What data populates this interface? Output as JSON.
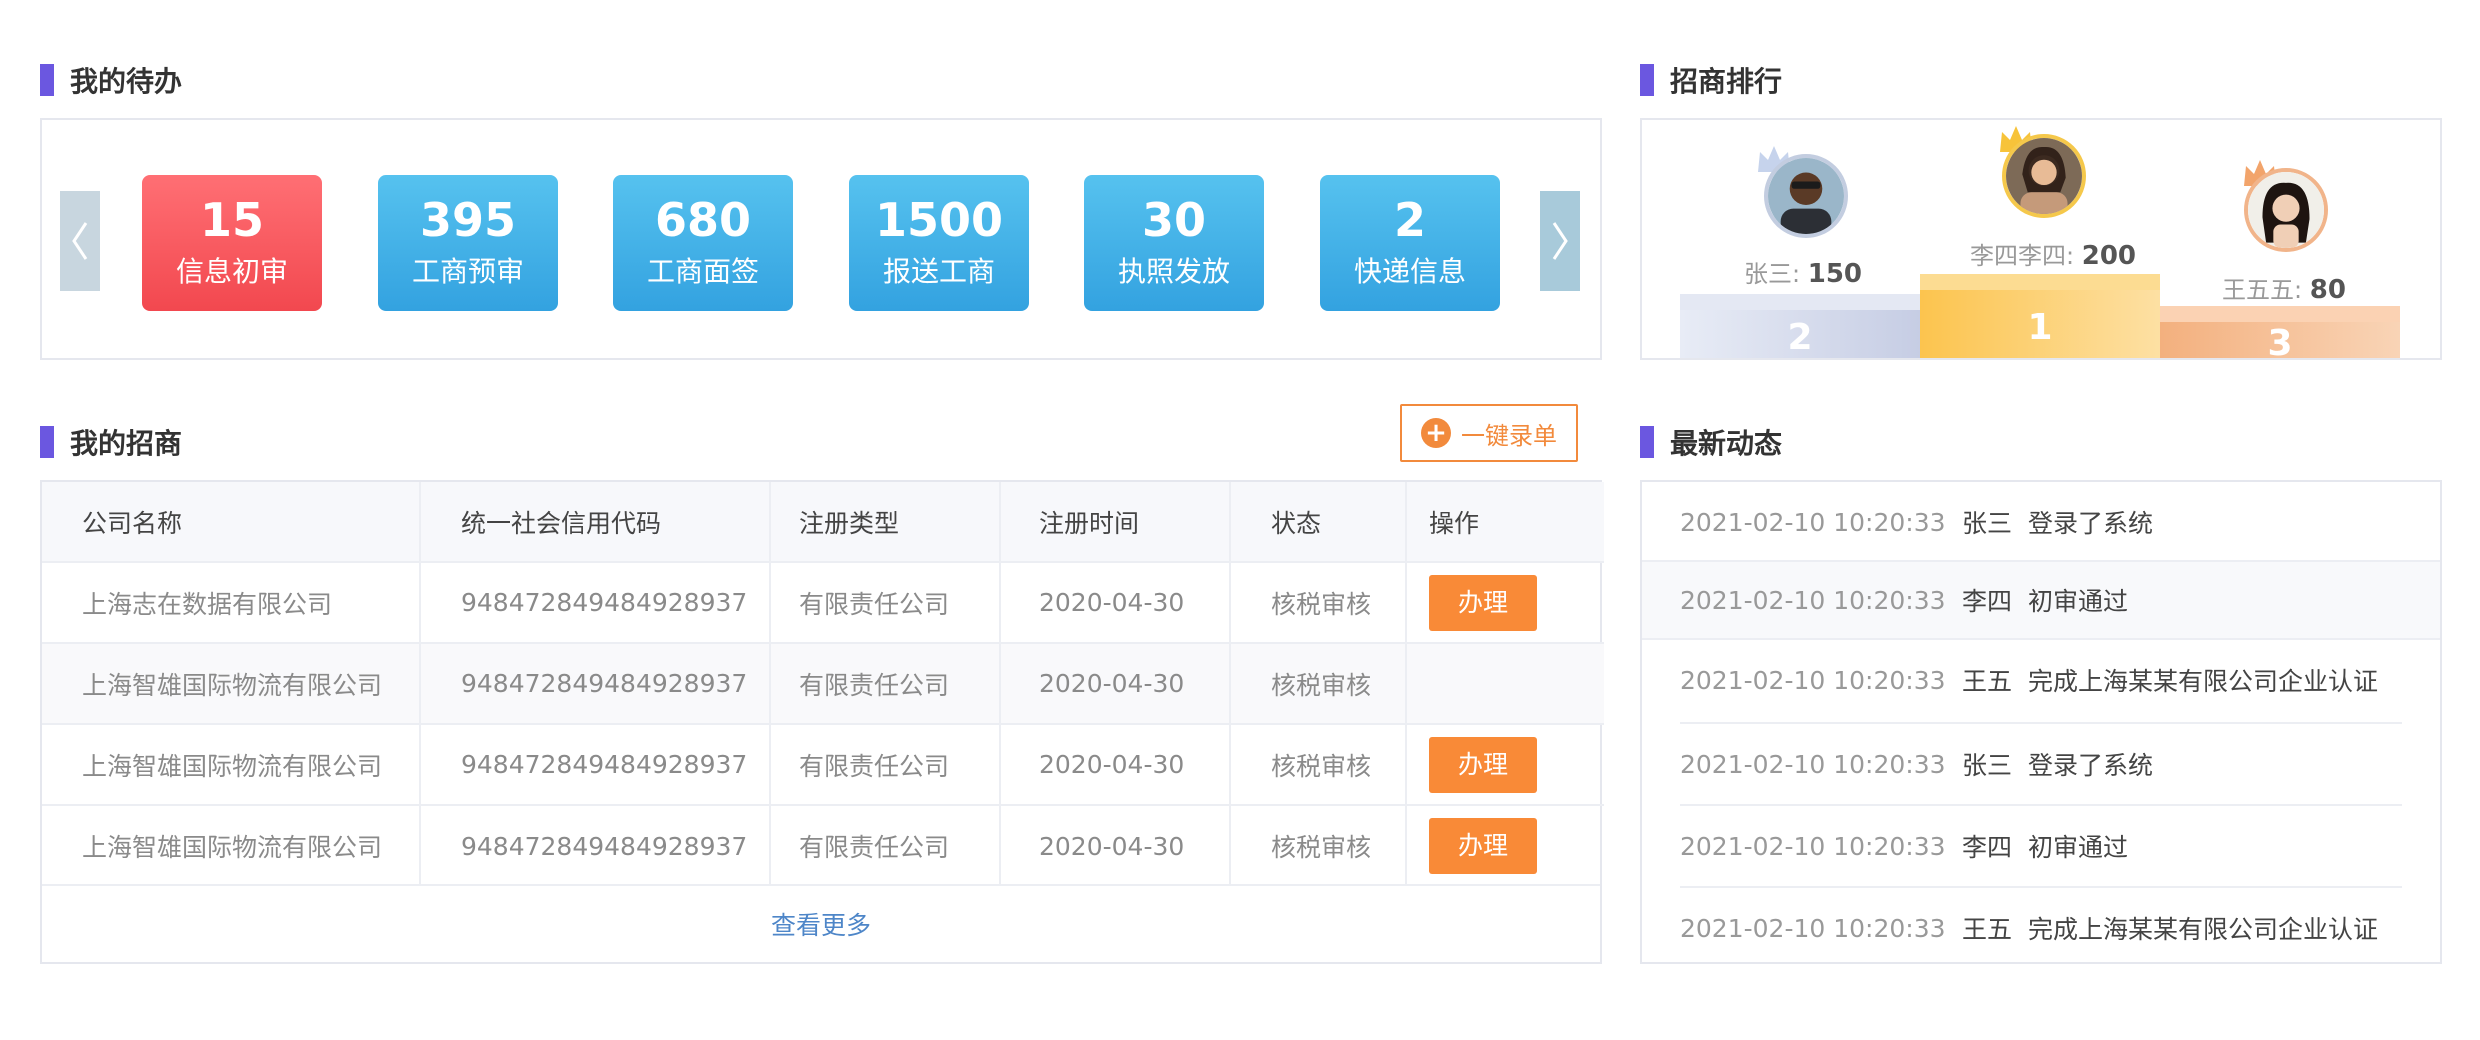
{
  "todo": {
    "title": "我的待办",
    "cards": [
      {
        "count": "15",
        "label": "信息初审",
        "color": "red"
      },
      {
        "count": "395",
        "label": "工商预审",
        "color": "blue"
      },
      {
        "count": "680",
        "label": "工商面签",
        "color": "blue"
      },
      {
        "count": "1500",
        "label": "报送工商",
        "color": "blue"
      },
      {
        "count": "30",
        "label": "执照发放",
        "color": "blue"
      },
      {
        "count": "2",
        "label": "快递信息",
        "color": "blue"
      }
    ]
  },
  "ranking": {
    "title": "招商排行",
    "entries": [
      {
        "rank": "2",
        "name": "张三",
        "score": "150"
      },
      {
        "rank": "1",
        "name": "李四李四",
        "score": "200"
      },
      {
        "rank": "3",
        "name": "王五五",
        "score": "80"
      }
    ],
    "separator": ":"
  },
  "company": {
    "title": "我的招商",
    "add_label": "一键录单",
    "headers": [
      "公司名称",
      "统一社会信用代码",
      "注册类型",
      "注册时间",
      "状态",
      "操作"
    ],
    "rows": [
      {
        "name": "上海志在数据有限公司",
        "code": "948472849484928937",
        "type": "有限责任公司",
        "date": "2020-04-30",
        "status": "核税审核",
        "action": "办理"
      },
      {
        "name": "上海智雄国际物流有限公司",
        "code": "948472849484928937",
        "type": "有限责任公司",
        "date": "2020-04-30",
        "status": "核税审核",
        "action": ""
      },
      {
        "name": "上海智雄国际物流有限公司",
        "code": "948472849484928937",
        "type": "有限责任公司",
        "date": "2020-04-30",
        "status": "核税审核",
        "action": "办理"
      },
      {
        "name": "上海智雄国际物流有限公司",
        "code": "948472849484928937",
        "type": "有限责任公司",
        "date": "2020-04-30",
        "status": "核税审核",
        "action": "办理"
      }
    ],
    "more_label": "查看更多"
  },
  "activity": {
    "title": "最新动态",
    "items": [
      {
        "time": "2021-02-10 10:20:33",
        "user": "张三",
        "message": "登录了系统"
      },
      {
        "time": "2021-02-10 10:20:33",
        "user": "李四",
        "message": "初审通过"
      },
      {
        "time": "2021-02-10 10:20:33",
        "user": "王五",
        "message": "完成上海某某有限公司企业认证"
      },
      {
        "time": "2021-02-10 10:20:33",
        "user": "张三",
        "message": "登录了系统"
      },
      {
        "time": "2021-02-10 10:20:33",
        "user": "李四",
        "message": "初审通过"
      },
      {
        "time": "2021-02-10 10:20:33",
        "user": "王五",
        "message": "完成上海某某有限公司企业认证"
      }
    ]
  },
  "colors": {
    "accent": "#6b57e0",
    "card_blue": "#3fb0e8",
    "card_red": "#f5535a",
    "action_orange": "#f98a37",
    "link_blue": "#4e86c8"
  },
  "icons": {
    "prev": "chevron-left-icon",
    "next": "chevron-right-icon",
    "add": "plus-circle-icon",
    "crown": "crown-icon"
  }
}
